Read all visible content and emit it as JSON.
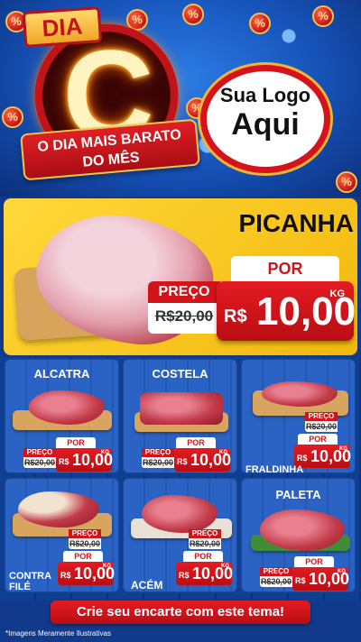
{
  "header": {
    "badge_dia": "DIA",
    "badge_letter": "C",
    "ribbon_line1": "O DIA MAIS BARATO",
    "ribbon_line2": "DO MÊS",
    "coin_symbol": "%",
    "logo_line1": "Sua Logo",
    "logo_line2": "Aqui"
  },
  "featured": {
    "name": "PICANHA",
    "por_label": "POR",
    "preco_label": "PREÇO",
    "old_price": "R$20,00",
    "currency": "R$",
    "price": "10,00",
    "unit": "KG"
  },
  "products": [
    {
      "name": "ALCATRA",
      "preco_label": "PREÇO",
      "old_price": "R$20,00",
      "por_label": "POR",
      "currency": "R$",
      "price": "10,00",
      "unit": "KG"
    },
    {
      "name": "COSTELA",
      "preco_label": "PREÇO",
      "old_price": "R$20,00",
      "por_label": "POR",
      "currency": "R$",
      "price": "10,00",
      "unit": "KG"
    },
    {
      "name": "FRALDINHA",
      "preco_label": "PREÇO",
      "old_price": "R$20,00",
      "por_label": "POR",
      "currency": "R$",
      "price": "10,00",
      "unit": "KG"
    },
    {
      "name": "CONTRA FILÉ",
      "name_line1": "CONTRA",
      "name_line2": "FILÉ",
      "preco_label": "PREÇO",
      "old_price": "R$20,00",
      "por_label": "POR",
      "currency": "R$",
      "price": "10,00",
      "unit": "KG"
    },
    {
      "name": "ACÉM",
      "preco_label": "PREÇO",
      "old_price": "R$20,00",
      "por_label": "POR",
      "currency": "R$",
      "price": "10,00",
      "unit": "KG"
    },
    {
      "name": "PALETA",
      "preco_label": "PREÇO",
      "old_price": "R$20,00",
      "por_label": "POR",
      "currency": "R$",
      "price": "10,00",
      "unit": "KG"
    }
  ],
  "cta": {
    "label": "Crie seu encarte com este tema!"
  },
  "footer": {
    "disclaimer": "*Imagens Meramente Ilustrativas"
  },
  "colors": {
    "brand_red": "#d0141a",
    "highlight_yellow": "#ffd83a",
    "background_blue": "#123a8c"
  }
}
